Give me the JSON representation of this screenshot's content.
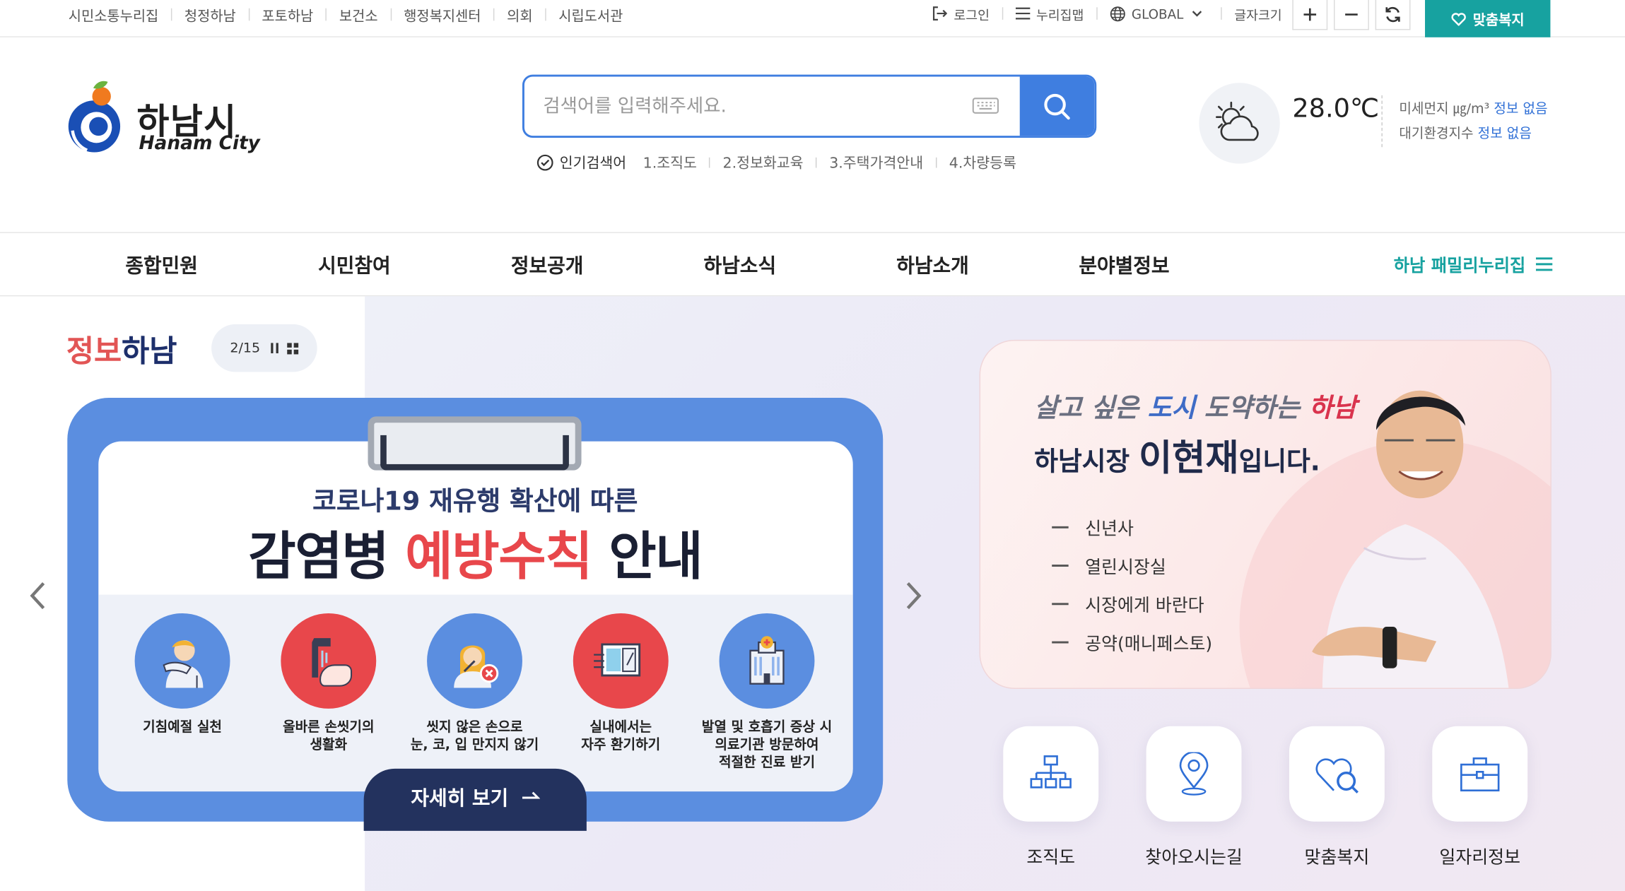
{
  "top_links": [
    "시민소통누리집",
    "청정하남",
    "포토하남",
    "보건소",
    "행정복지센터",
    "의회",
    "시립도서관"
  ],
  "util": {
    "login": "로그인",
    "sitemap": "누리집맵",
    "global": "GLOBAL",
    "fontsize": "글자크기",
    "custom_welfare": "맞춤복지"
  },
  "logo": {
    "ko": "하남시",
    "en": "Hanam City"
  },
  "search": {
    "placeholder": "검색어를 입력해주세요."
  },
  "popular": {
    "title": "인기검색어",
    "keywords": [
      "1.조직도",
      "2.정보화교육",
      "3.주택가격안내",
      "4.차량등록"
    ]
  },
  "weather": {
    "temperature": "28.0℃",
    "fine_dust_label": "미세먼지 ㎍/m³",
    "fine_dust_value": "정보 없음",
    "air_index_label": "대기환경지수",
    "air_index_value": "정보 없음"
  },
  "gnb": [
    "종합민원",
    "시민참여",
    "정보공개",
    "하남소식",
    "하남소개",
    "분야별정보"
  ],
  "family_link": "하남 패밀리누리집",
  "info": {
    "title_a": "정보",
    "title_b": "하남",
    "pager": "2/15"
  },
  "banner": {
    "sub": "코로나19 재유행 확산에 따른",
    "main_a": "감염병 ",
    "main_b": "예방수칙",
    "main_c": " 안내",
    "tips": [
      {
        "label": "기침예절 실천",
        "color": "#5b8ee0"
      },
      {
        "label": "올바른 손씻기의\n생활화",
        "color": "#e8474b"
      },
      {
        "label": "씻지 않은 손으로\n눈, 코, 입 만지지 않기",
        "color": "#5b8ee0"
      },
      {
        "label": "실내에서는\n자주 환기하기",
        "color": "#e8474b"
      },
      {
        "label": "발열 및 호흡기 증상 시\n의료기관 방문하여\n적절한 진료 받기",
        "color": "#5b8ee0"
      }
    ],
    "detail": "자세히 보기"
  },
  "mayor": {
    "slogan_a": "살고 싶은 ",
    "slogan_b": "도시",
    "slogan_c": " 도약하는 ",
    "slogan_d": "하남",
    "name_a": "하남시장 ",
    "name_b": "이현재",
    "name_c": "입니다.",
    "links": [
      "신년사",
      "열린시장실",
      "시장에게 바란다",
      "공약(매니페스토)"
    ]
  },
  "quick_menu": [
    "조직도",
    "찾아오시는길",
    "맞춤복지",
    "일자리정보"
  ],
  "colors": {
    "accent_teal": "#17a2a0",
    "search_blue": "#3f7ee0",
    "banner_blue": "#5b8ee0",
    "banner_red": "#e8474b",
    "navy": "#23325e"
  }
}
